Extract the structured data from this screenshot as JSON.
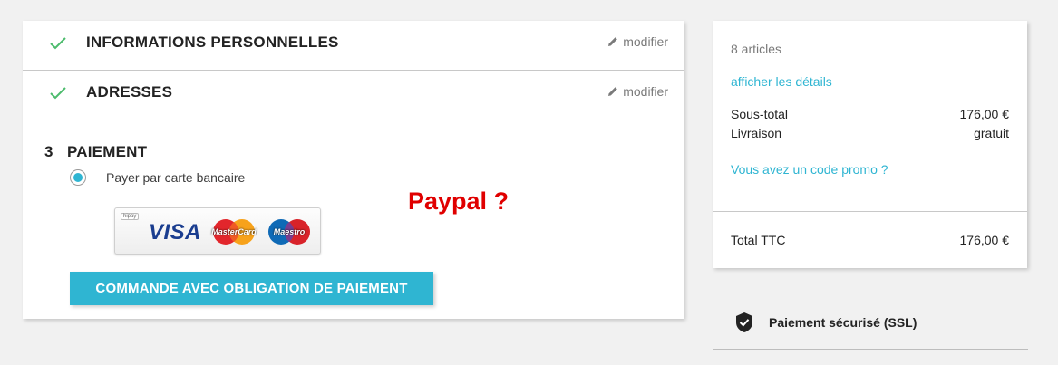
{
  "steps": [
    {
      "title": "INFORMATIONS PERSONNELLES",
      "edit_label": "modifier"
    },
    {
      "title": "ADRESSES",
      "edit_label": "modifier"
    }
  ],
  "payment": {
    "number": "3",
    "title": "PAIEMENT",
    "option_label": "Payer par carte bancaire",
    "card_logos": {
      "provider": "hipay",
      "visa": "VISA",
      "mastercard": "MasterCard",
      "maestro": "Maestro"
    },
    "annotation": "Paypal ?",
    "submit_label": "COMMANDE AVEC OBLIGATION DE PAIEMENT"
  },
  "summary": {
    "count": "8 articles",
    "details_link": "afficher les détails",
    "subtotal_label": "Sous-total",
    "subtotal_value": "176,00 €",
    "shipping_label": "Livraison",
    "shipping_value": "gratuit",
    "promo_link": "Vous avez un code promo ?",
    "total_label": "Total TTC",
    "total_value": "176,00 €"
  },
  "security": {
    "label": "Paiement sécurisé (SSL)"
  },
  "colors": {
    "accent": "#2fb5d2",
    "check": "#4cbb6c",
    "annotation": "#e00000",
    "background": "#f1f1f1"
  },
  "icons": {
    "check": "check-icon",
    "edit": "pencil-icon",
    "shield": "shield-check-icon"
  }
}
